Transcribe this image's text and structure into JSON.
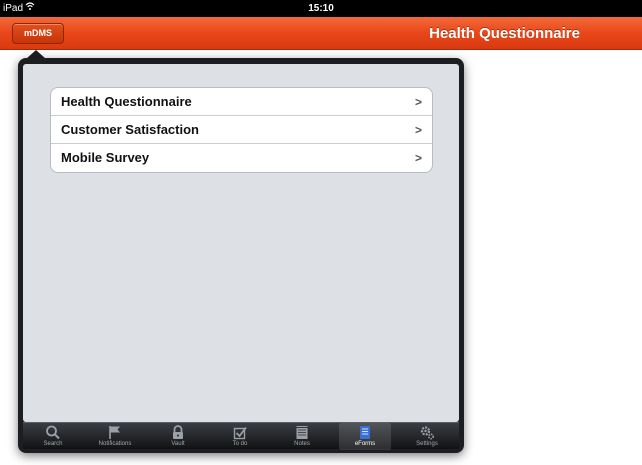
{
  "statusbar": {
    "device": "iPad",
    "wifi_icon": "wifi-icon",
    "time": "15:10"
  },
  "navbar": {
    "back_button": "mDMS",
    "title": "Health Questionnaire"
  },
  "menu": {
    "items": [
      {
        "label": "Health Questionnaire",
        "chevron": ">"
      },
      {
        "label": "Customer Satisfaction",
        "chevron": ">"
      },
      {
        "label": "Mobile Survey",
        "chevron": ">"
      }
    ]
  },
  "tabbar": {
    "active": "eForms",
    "tabs": [
      {
        "label": "Search",
        "icon": "search-icon"
      },
      {
        "label": "Notifications",
        "icon": "flag-icon"
      },
      {
        "label": "Vault",
        "icon": "lock-icon"
      },
      {
        "label": "To do",
        "icon": "checkbox-icon"
      },
      {
        "label": "Notes",
        "icon": "notepad-icon"
      },
      {
        "label": "eForms",
        "icon": "form-icon"
      },
      {
        "label": "Settings",
        "icon": "gears-icon"
      }
    ]
  },
  "colors": {
    "navbar": "#e9471a",
    "popover": "#1c1e22",
    "content_bg": "#dde1e6",
    "tab_active": "#3b6fd1"
  }
}
